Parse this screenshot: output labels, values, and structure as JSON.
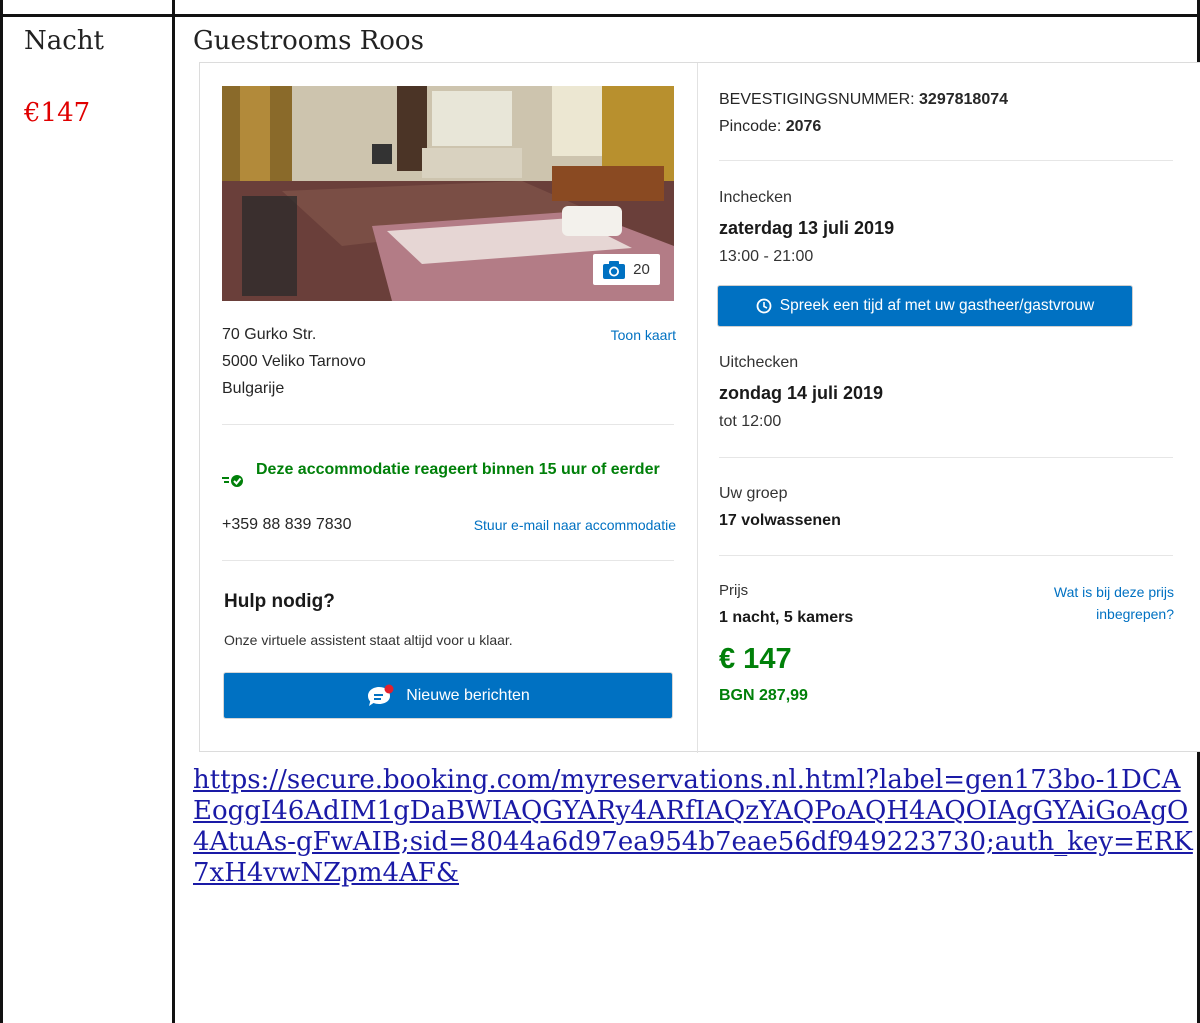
{
  "table": {
    "night_label": "Nacht",
    "night_price": "€147",
    "hotel_name": "Guestrooms Roos"
  },
  "property": {
    "photo_count": "20",
    "address_line1": "70 Gurko Str.",
    "address_line2": "5000 Veliko Tarnovo",
    "address_line3": "Bulgarije",
    "map_link": "Toon kaart",
    "response_time": "Deze accommodatie reageert binnen 15 uur of eerder",
    "phone": "+359 88 839 7830",
    "email_link": "Stuur e-mail naar accommodatie",
    "help_title": "Hulp nodig?",
    "help_subtitle": "Onze virtuele assistent staat altijd voor u klaar.",
    "messages_button": "Nieuwe berichten"
  },
  "booking": {
    "confirmation_label": "BEVESTIGINGSNUMMER:",
    "confirmation_number": "3297818074",
    "pin_label": "Pincode:",
    "pin": "2076",
    "checkin_label": "Inchecken",
    "checkin_date": "zaterdag 13 juli 2019",
    "checkin_time": "13:00 - 21:00",
    "arrange_time_button": "Spreek een tijd af met uw gastheer/gastvrouw",
    "checkout_label": "Uitchecken",
    "checkout_date": "zondag 14 juli 2019",
    "checkout_time": "tot 12:00",
    "group_label": "Uw groep",
    "group_value": "17 volwassenen",
    "price_label": "Prijs",
    "price_summary": "1 nacht, 5 kamers",
    "price_included_link": "Wat is bij deze prijs inbegrepen?",
    "price_eur": "€ 147",
    "price_bgn": "BGN 287,99"
  },
  "url": "https://secure.booking.com/myreservations.nl.html?label=gen173bo-1DCAEoggI46AdIM1gDaBWIAQGYARy4ARfIAQzYAQPoAQH4AQOIAgGYAiGoAgO4AtuAs-gFwAIB;sid=8044a6d97ea954b7eae56df949223730;auth_key=ERK7xH4vwNZpm4AF&",
  "colors": {
    "brand_blue": "#0071c2",
    "success_green": "#008009",
    "price_red": "#e00000",
    "link_blue": "#1a1aa6"
  }
}
